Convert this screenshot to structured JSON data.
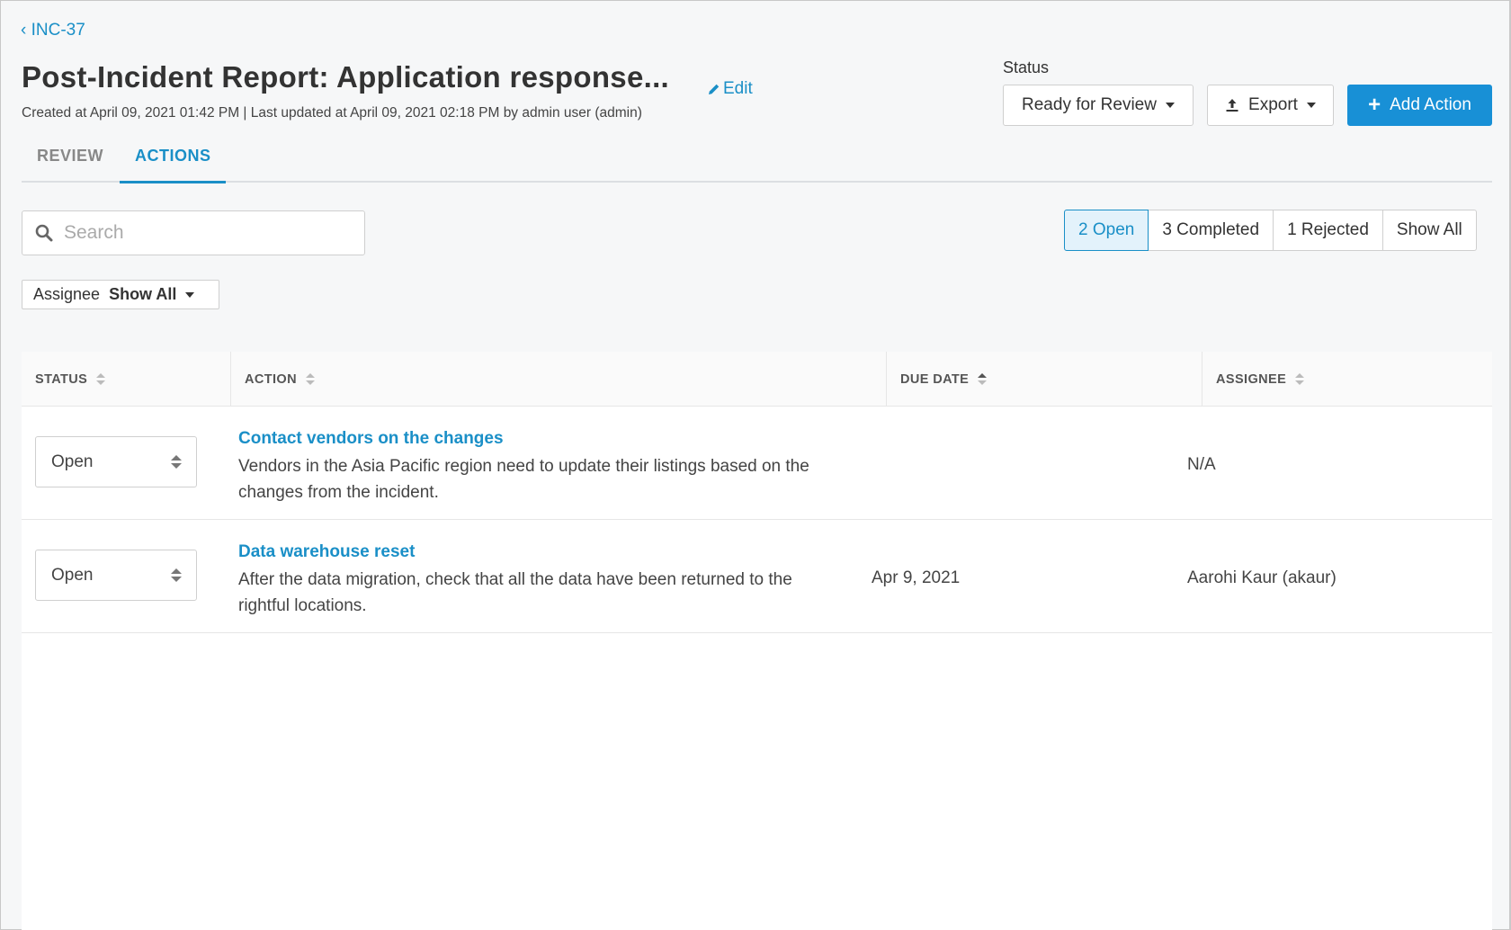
{
  "breadcrumb": {
    "back_label": "‹ INC-37"
  },
  "header": {
    "title": "Post-Incident Report: Application response...",
    "edit_label": "Edit",
    "meta": "Created at April 09, 2021 01:42 PM | Last updated at April 09, 2021 02:18 PM by admin user (admin)"
  },
  "status": {
    "label": "Status",
    "selected": "Ready for Review"
  },
  "toolbar": {
    "export_label": "Export",
    "add_action_label": "Add Action"
  },
  "tabs": [
    {
      "label": "REVIEW",
      "active": false
    },
    {
      "label": "ACTIONS",
      "active": true
    }
  ],
  "search": {
    "placeholder": "Search",
    "value": ""
  },
  "filters": [
    {
      "label": "2 Open",
      "active": true
    },
    {
      "label": "3 Completed",
      "active": false
    },
    {
      "label": "1 Rejected",
      "active": false
    },
    {
      "label": "Show All",
      "active": false
    }
  ],
  "assignee_filter": {
    "label": "Assignee",
    "value": "Show All"
  },
  "table": {
    "columns": [
      "STATUS",
      "ACTION",
      "DUE DATE",
      "ASSIGNEE"
    ],
    "rows": [
      {
        "status": "Open",
        "title": "Contact vendors on the changes",
        "description": "Vendors in the Asia Pacific region need to update their listings based on the changes from the incident.",
        "due_date": "",
        "assignee": "N/A"
      },
      {
        "status": "Open",
        "title": "Data warehouse reset",
        "description": "After the data migration, check that all the data have been returned to the rightful locations.",
        "due_date": "Apr 9, 2021",
        "assignee": "Aarohi Kaur (akaur)"
      }
    ]
  },
  "colors": {
    "accent": "#1a8fc7",
    "primary_button": "#1890d6",
    "background": "#f6f7f8"
  }
}
